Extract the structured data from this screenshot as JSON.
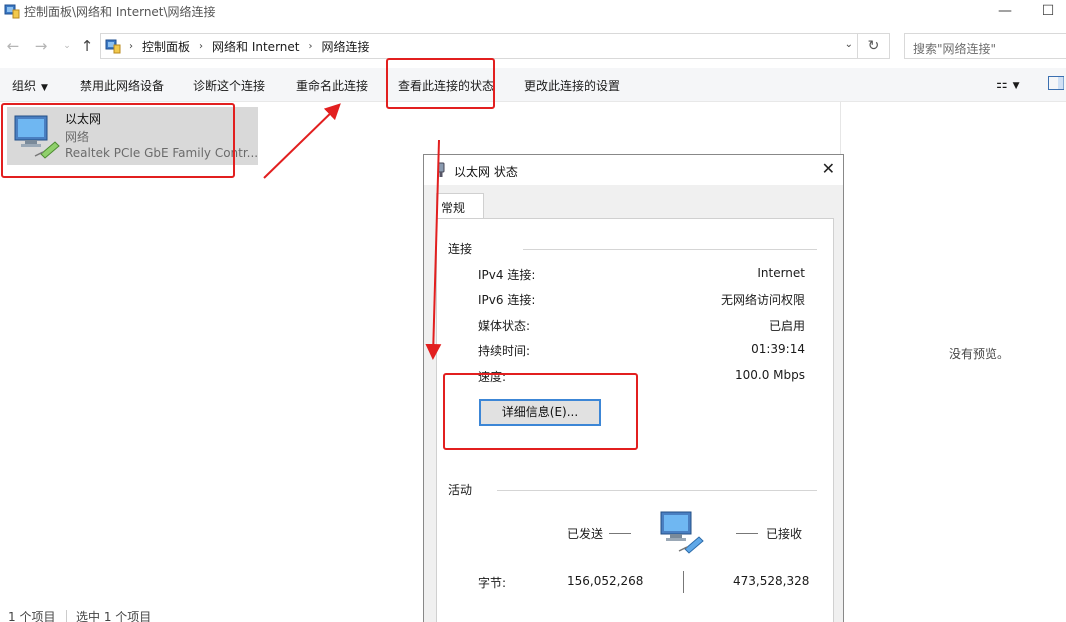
{
  "window": {
    "title": "控制面板\\网络和 Internet\\网络连接"
  },
  "address": {
    "crumbs": [
      "控制面板",
      "网络和 Internet",
      "网络连接"
    ],
    "search_placeholder": "搜索\"网络连接\""
  },
  "toolbar": {
    "organize": "组织",
    "disable": "禁用此网络设备",
    "diagnose": "诊断这个连接",
    "rename": "重命名此连接",
    "view_status": "查看此连接的状态",
    "change_settings": "更改此连接的设置"
  },
  "connection": {
    "name": "以太网",
    "network": "网络",
    "adapter": "Realtek PCIe GbE Family Contr..."
  },
  "preview": {
    "empty_text": "没有预览。"
  },
  "statusbar": {
    "count": "1 个项目",
    "selected": "选中 1 个项目"
  },
  "dialog": {
    "title": "以太网 状态",
    "tab": "常规",
    "connection_group": "连接",
    "rows": [
      {
        "label": "IPv4 连接:",
        "value": "Internet"
      },
      {
        "label": "IPv6 连接:",
        "value": "无网络访问权限"
      },
      {
        "label": "媒体状态:",
        "value": "已启用"
      },
      {
        "label": "持续时间:",
        "value": "01:39:14"
      },
      {
        "label": "速度:",
        "value": "100.0 Mbps"
      }
    ],
    "details_button": "详细信息(E)...",
    "activity_group": "活动",
    "sent_label": "已发送",
    "received_label": "已接收",
    "bytes_label": "字节:",
    "bytes_sent": "156,052,268",
    "bytes_received": "473,528,328"
  },
  "annotation_color": "#e21f1f",
  "icons": [
    "back-arrow-icon",
    "forward-arrow-icon",
    "up-arrow-icon",
    "control-panel-icon",
    "refresh-icon",
    "view-options-icon",
    "preview-pane-icon",
    "network-adapter-icon",
    "ethernet-icon"
  ]
}
